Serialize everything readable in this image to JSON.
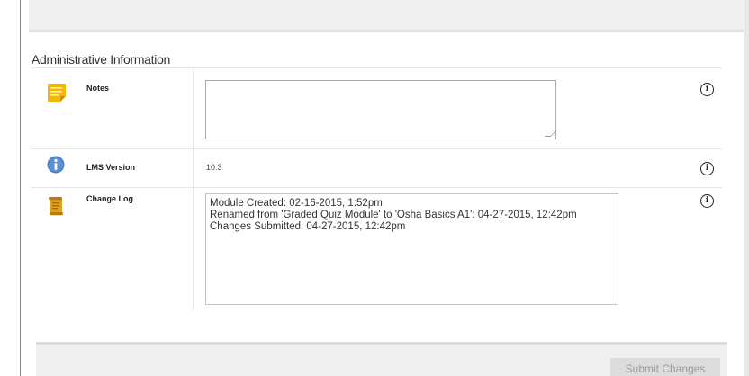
{
  "section": {
    "title": "Administrative Information"
  },
  "rows": {
    "notes": {
      "label": "Notes",
      "icon": "notes-icon",
      "value": ""
    },
    "lms_version": {
      "label": "LMS Version",
      "icon": "info-circle-icon",
      "value": "10.3"
    },
    "change_log": {
      "label": "Change Log",
      "icon": "scroll-icon",
      "lines": [
        "Module Created: 02-16-2015, 1:52pm",
        "Renamed from 'Graded Quiz Module' to 'Osha Basics A1': 04-27-2015, 12:42pm",
        "Changes Submitted: 04-27-2015, 12:42pm"
      ]
    }
  },
  "info_button_glyph": "i",
  "footer": {
    "submit_label": "Submit Changes"
  },
  "colors": {
    "notes_icon": "#f5b800",
    "info_icon": "#4a7fc1",
    "scroll_icon": "#e0a020"
  }
}
